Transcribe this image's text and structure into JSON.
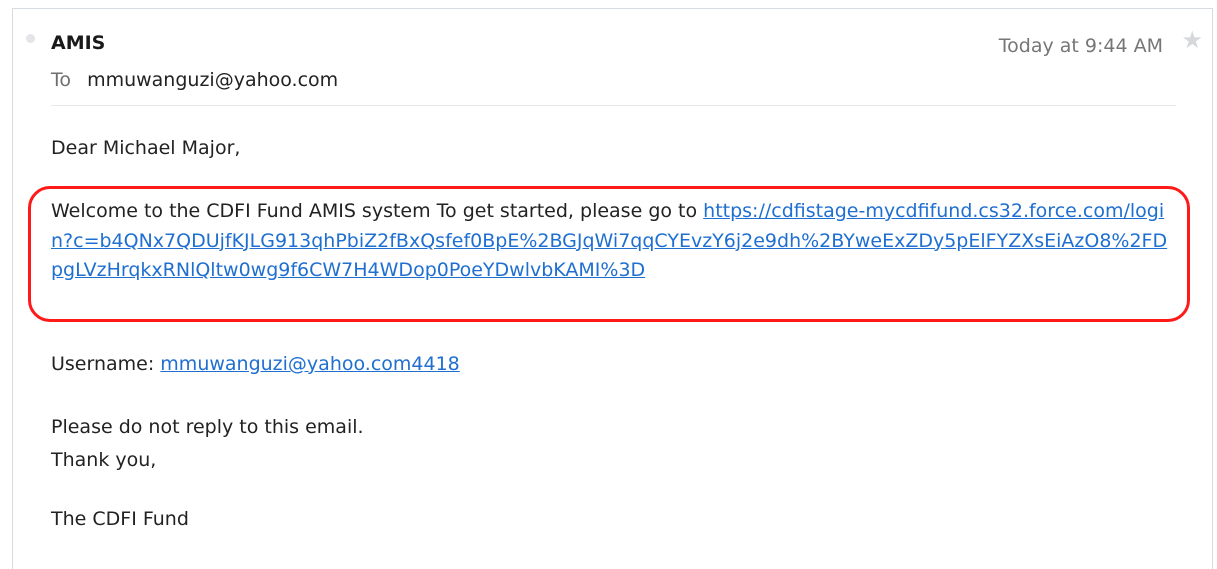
{
  "email": {
    "sender": "AMIS",
    "to_label": "To",
    "to_address": "mmuwanguzi@yahoo.com",
    "timestamp": "Today at 9:44 AM",
    "star_icon": "star-icon",
    "greeting": "Dear Michael Major,",
    "welcome_text": "Welcome to the CDFI Fund AMIS system To get started, please go to ",
    "login_link": "https://cdfistage-mycdfifund.cs32.force.com/login?c=b4QNx7QDUjfKJLG913qhPbiZ2fBxQsfef0BpE%2BGJqWi7qqCYEvzY6j2e9dh%2BYweExZDy5pElFYZXsEiAzO8%2FDpgLVzHrqkxRNlQltw0wg9f6CW7H4WDop0PoeYDwlvbKAMI%3D",
    "username_label": "Username: ",
    "username_value": "mmuwanguzi@yahoo.com4418",
    "no_reply": "Please do not reply to this email.",
    "thanks": "Thank you,",
    "signature": "The CDFI Fund"
  },
  "colors": {
    "link": "#1f6fd1",
    "highlight_border": "#ff1a1a",
    "frame_border": "#d7dbe2"
  }
}
